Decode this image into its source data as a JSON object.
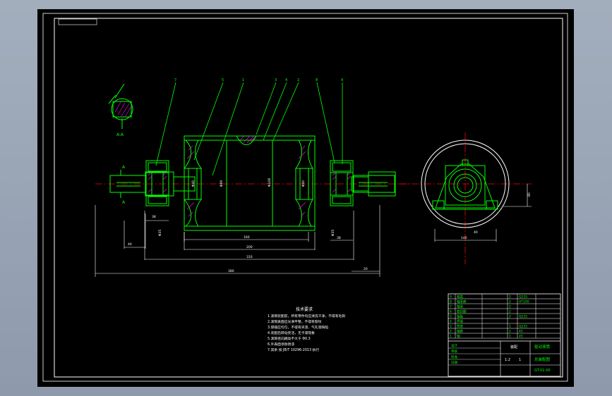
{
  "drawing": {
    "colors": {
      "viewport_bg": "#93a0b1",
      "canvas": "#000000",
      "frame": "#ffffff",
      "outline": "#00ff00",
      "center_line": "#ff0000",
      "dimension": "#ffffff",
      "hatch": "#ff00ff",
      "leader": "#00ff00",
      "note_text": "#ffffff"
    },
    "part_balloons": [
      "7",
      "5",
      "1",
      "3",
      "4",
      "2",
      "8",
      "9"
    ],
    "section_label": "A-A",
    "section_marks": [
      "A",
      "A"
    ],
    "dimensions": {
      "bearing_width_left": "38",
      "shaft_end": "40",
      "bearing_seat_left": "Φ35",
      "hub_bore": "Φ40",
      "shell_inner": "Φ89",
      "shell_outer": "Φ108",
      "hub_bore_right": "Φ40",
      "bearing_seat_right": "Φ35",
      "shell_length": "160",
      "between_bearings": "200",
      "bearing_span": "310",
      "overall": "380",
      "shaft_right": "20",
      "bearing_width_right": "38",
      "side_height": "80",
      "side_width": "40",
      "side_base": "140"
    },
    "technical_notes": {
      "title": "技术要求",
      "lines": [
        "1.滚筒装配前，所有零件均应清洗干净，不得有毛刺",
        "2.滚筒表面应光滑平整，不得有裂纹",
        "3.焊缝应均匀，不得有夹渣、气孔等缺陷",
        "4.装配后转动灵活，无卡滞现象",
        "5.滚筒径向跳动不大于 Φ0.3",
        "6.外表面涂防锈漆",
        "7.其余 按 JB/T 10296-2013 执行"
      ]
    },
    "title_block": {
      "drawing_title": "驱动滚筒",
      "drawing_subtitle": "总装配图",
      "drawing_number": "GT-01-00",
      "scale": "1:2",
      "sheet": "1",
      "material": "装配",
      "rows": [
        [
          "9",
          "端盖",
          "2",
          "Q235"
        ],
        [
          "8",
          "轴承座",
          "2",
          "HT200"
        ],
        [
          "7",
          "轴承",
          "2",
          ""
        ],
        [
          "6",
          "密封圈",
          "2",
          ""
        ],
        [
          "5",
          "辐板",
          "2",
          "Q235"
        ],
        [
          "4",
          "焊缝",
          "",
          ""
        ],
        [
          "3",
          "筒皮",
          "1",
          "Q235"
        ],
        [
          "2",
          "轴套",
          "2",
          "45"
        ],
        [
          "1",
          "轴",
          "1",
          "45"
        ]
      ],
      "labels": {
        "designer": "设计",
        "checker": "审核",
        "approver": "批准",
        "date": "日期"
      }
    }
  }
}
